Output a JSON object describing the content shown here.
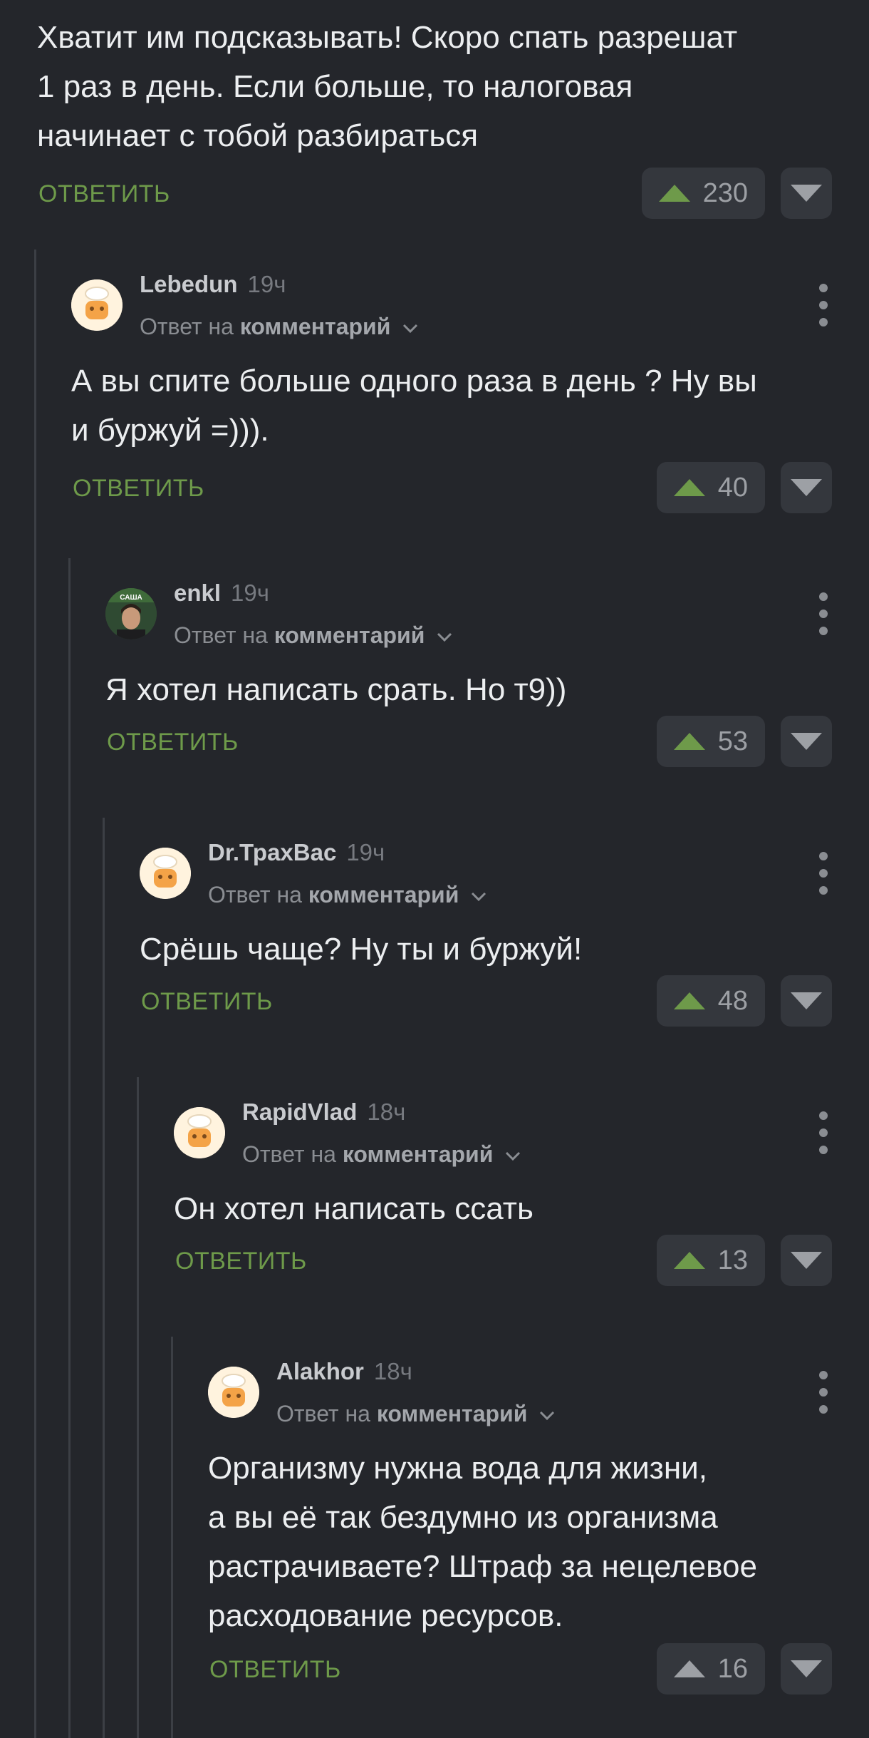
{
  "top_comment": {
    "text_lines": [
      "Хватит им подсказывать! Скоро спать разрешат",
      "1 раз в день. Если больше, то налоговая",
      "начинает с тобой разбираться"
    ],
    "reply_label": "ОТВЕТИТЬ",
    "score": "230"
  },
  "comments": [
    {
      "author": "Lebedun",
      "time": "19ч",
      "reply_prefix": "Ответ на",
      "reply_target": "комментарий",
      "text_lines": [
        "А вы спите больше одного раза в день ? Ну вы",
        "и буржуй =)))."
      ],
      "reply_label": "ОТВЕТИТЬ",
      "score": "40"
    },
    {
      "author": "enkl",
      "time": "19ч",
      "reply_prefix": "Ответ на",
      "reply_target": "комментарий",
      "avatar_caption": "САША",
      "text_lines": [
        "Я хотел написать срать. Но т9))"
      ],
      "reply_label": "ОТВЕТИТЬ",
      "score": "53"
    },
    {
      "author": "Dr.ТрахВас",
      "time": "19ч",
      "reply_prefix": "Ответ на",
      "reply_target": "комментарий",
      "text_lines": [
        "Срёшь чаще? Ну ты и буржуй!"
      ],
      "reply_label": "ОТВЕТИТЬ",
      "score": "48"
    },
    {
      "author": "RapidVlad",
      "time": "18ч",
      "reply_prefix": "Ответ на",
      "reply_target": "комментарий",
      "text_lines": [
        "Он хотел написать ссать"
      ],
      "reply_label": "ОТВЕТИТЬ",
      "score": "13"
    },
    {
      "author": "Alakhor",
      "time": "18ч",
      "reply_prefix": "Ответ на",
      "reply_target": "комментарий",
      "text_lines": [
        "Организму нужна вода для жизни,",
        "а вы её так бездумно из организма",
        "растрачиваете? Штраф за нецелевое",
        "расходование ресурсов."
      ],
      "reply_label": "ОТВЕТИТЬ",
      "score": "16"
    }
  ],
  "colors": {
    "background": "#24262b",
    "reply_green": "#6e9a4a",
    "upvote_active": "#6e9a4a",
    "upvote_neutral": "#9da0a5"
  }
}
